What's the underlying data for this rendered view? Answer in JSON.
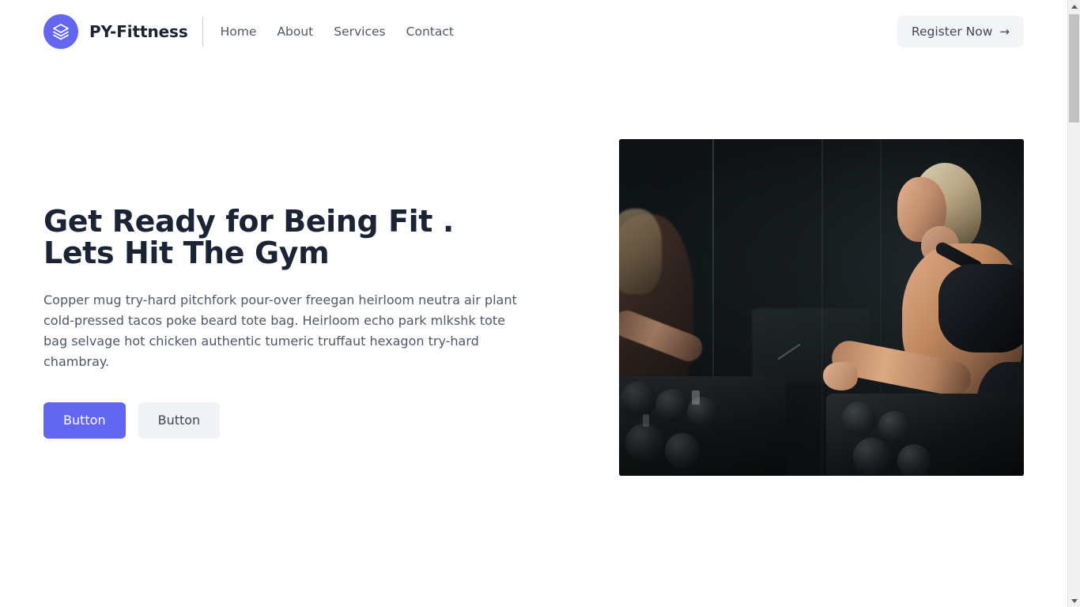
{
  "header": {
    "brand_name": "PY-Fittness",
    "logo_icon": "layers-stack-icon",
    "nav": [
      {
        "label": "Home"
      },
      {
        "label": "About"
      },
      {
        "label": "Services"
      },
      {
        "label": "Contact"
      }
    ],
    "register_label": "Register Now",
    "register_arrow": "→"
  },
  "hero": {
    "title": "Get Ready for Being Fit .\nLets Hit The Gym",
    "paragraph": "Copper mug try-hard pitchfork pour-over freegan heirloom neutra air plant cold-pressed tacos poke beard tote bag. Heirloom echo park mlkshk tote bag selvage hot chicken authentic tumeric truffaut hexagon try-hard chambray.",
    "primary_button": "Button",
    "secondary_button": "Button",
    "image_alt": "woman lifting dumbbells in a dark gym with mirror reflection"
  },
  "colors": {
    "accent": "#6366F1",
    "heading": "#1B2434",
    "body_text": "#4F5766",
    "secondary_button_bg": "#F1F2F6",
    "register_bg": "#F3F4F6",
    "page_bg": "#FFFFFF"
  },
  "scrollbar": {
    "up_arrow": "▲",
    "down_arrow": "▼"
  }
}
